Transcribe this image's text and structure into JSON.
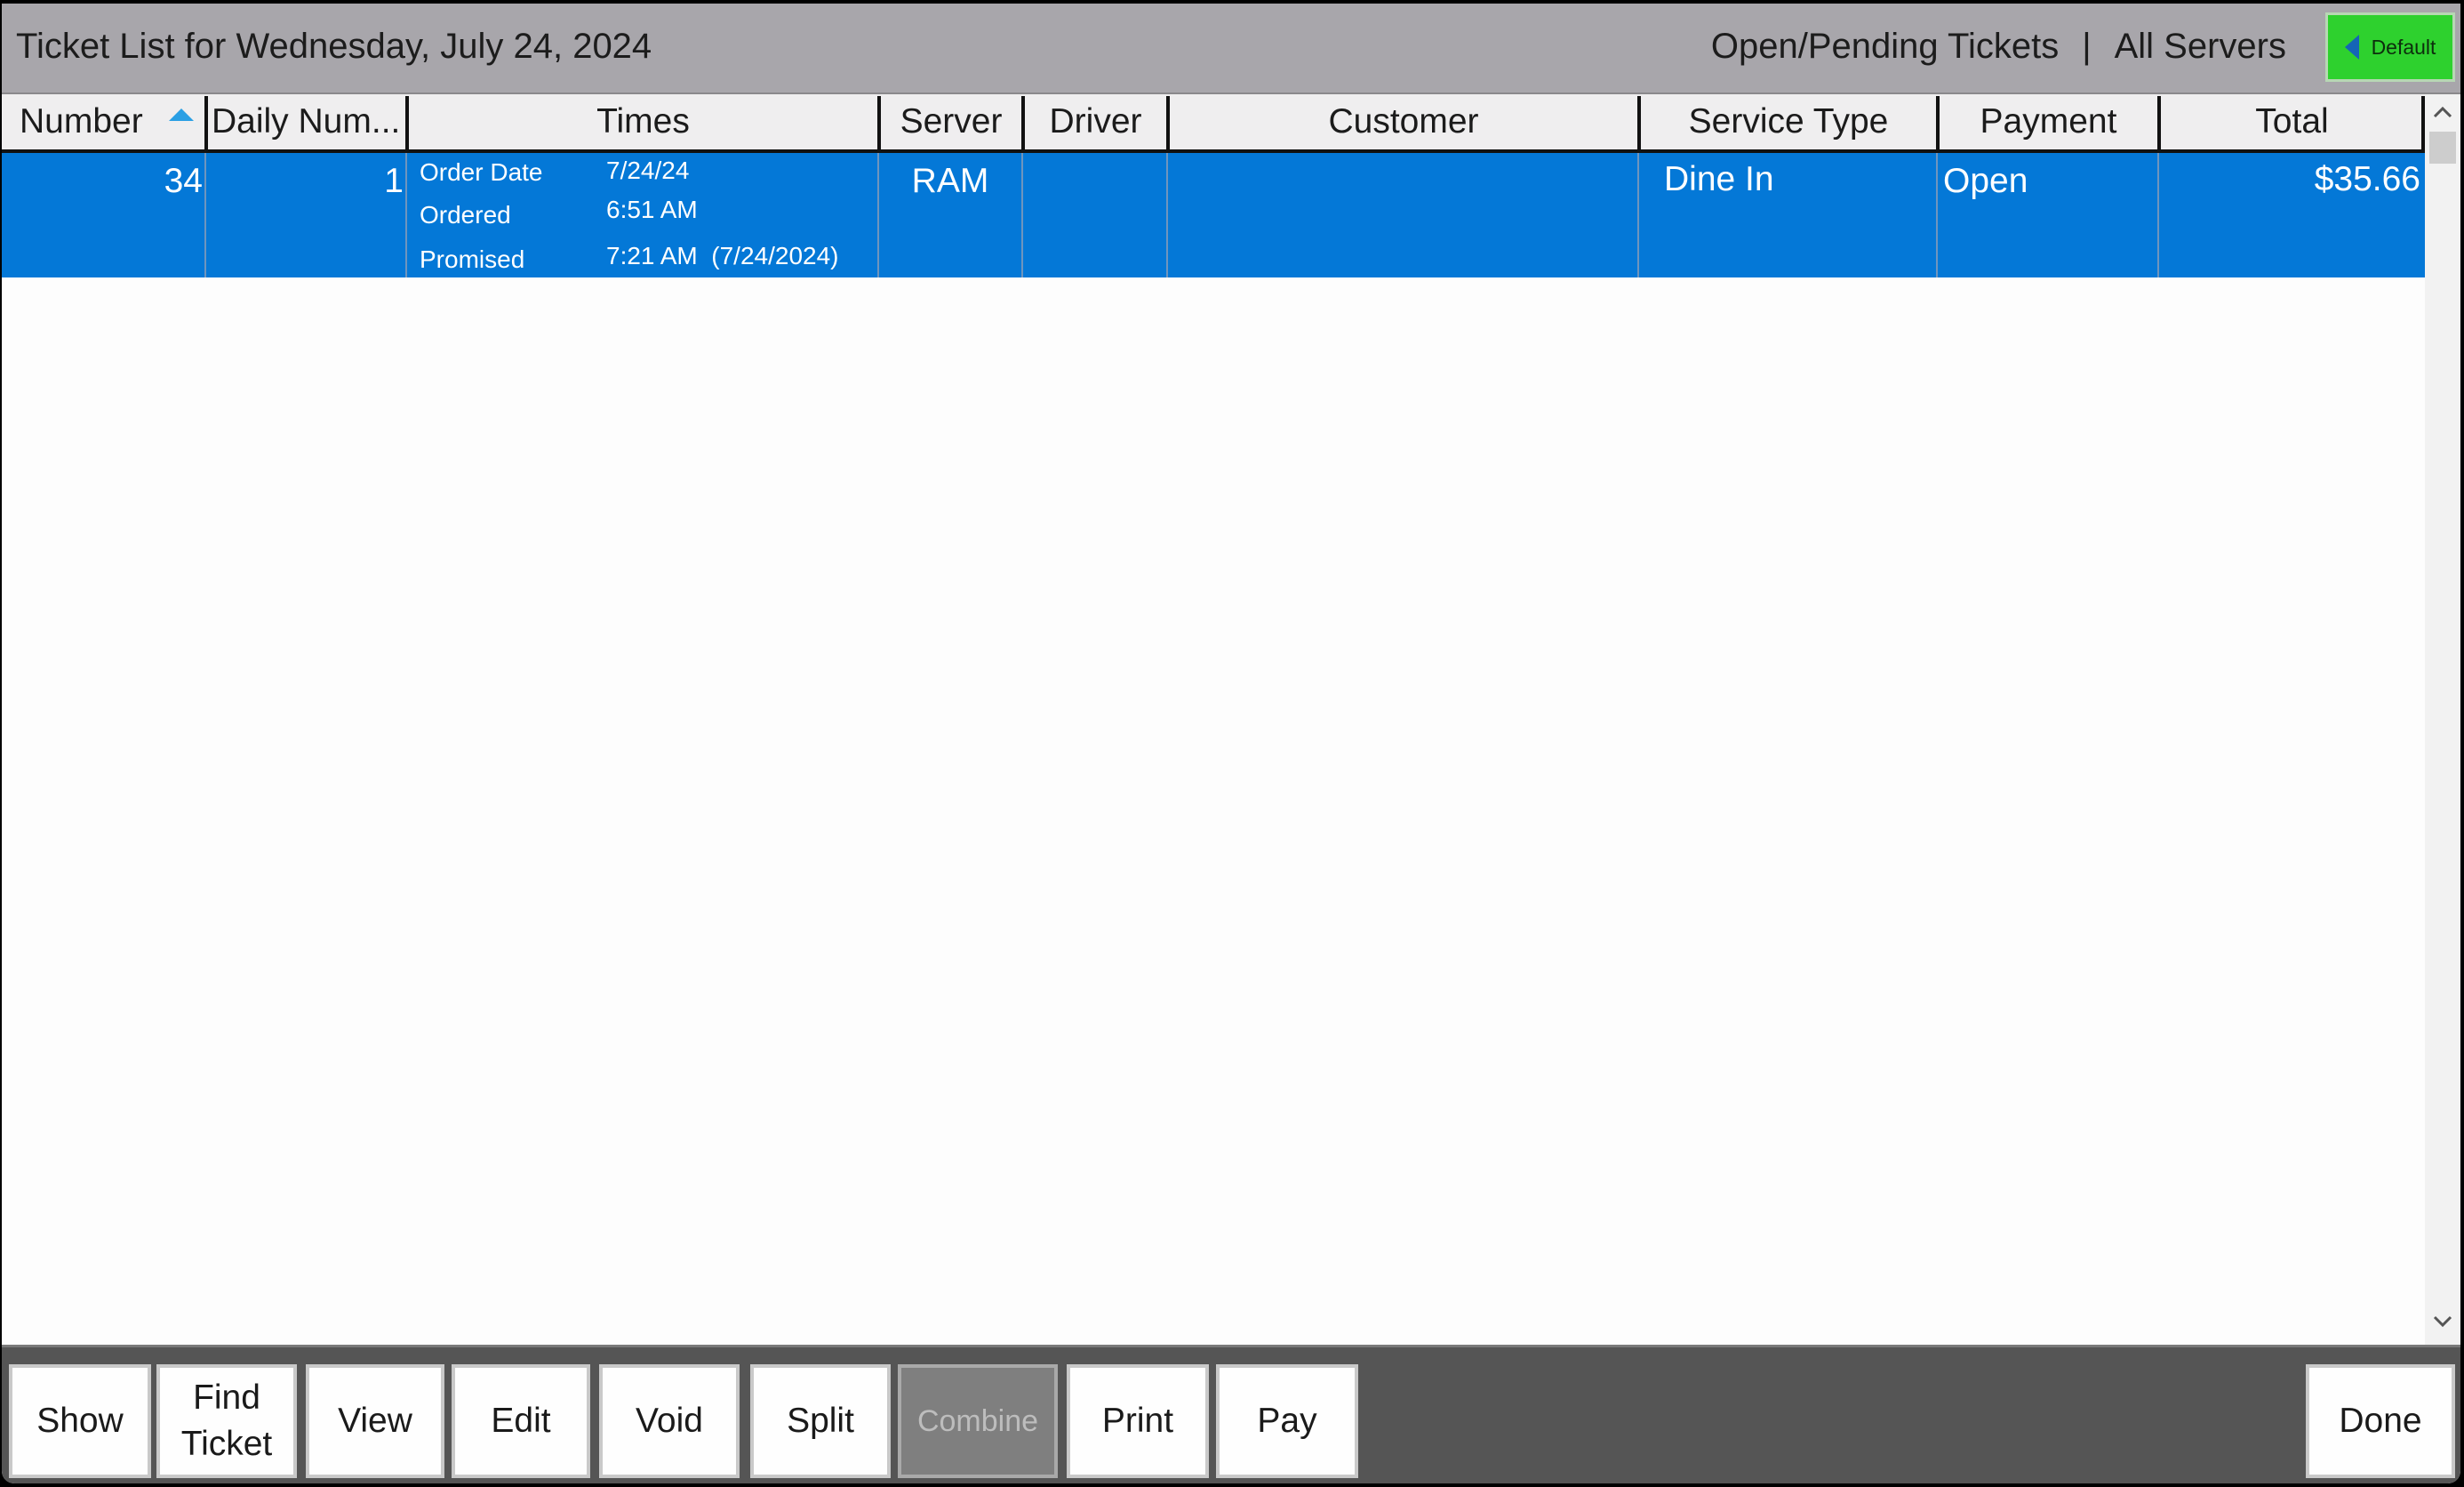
{
  "title_bar": {
    "title": "Ticket List for Wednesday, July 24, 2024",
    "filter_status": "Open/Pending Tickets",
    "separator": "|",
    "filter_server": "All Servers",
    "default_button": {
      "label": "Default",
      "icon": "caret-left-icon",
      "color": "#2ed12e"
    }
  },
  "grid": {
    "columns": [
      {
        "key": "number",
        "label": "Number",
        "sorted": "ascending"
      },
      {
        "key": "daily_number",
        "label": "Daily Num..."
      },
      {
        "key": "times",
        "label": "Times"
      },
      {
        "key": "server",
        "label": "Server"
      },
      {
        "key": "driver",
        "label": "Driver"
      },
      {
        "key": "customer",
        "label": "Customer"
      },
      {
        "key": "service_type",
        "label": "Service Type"
      },
      {
        "key": "payment",
        "label": "Payment"
      },
      {
        "key": "total",
        "label": "Total"
      }
    ],
    "rows": [
      {
        "selected": true,
        "number": "34",
        "daily_number": "1",
        "times": {
          "order_date_label": "Order Date",
          "order_date": "7/24/24",
          "ordered_label": "Ordered",
          "ordered": "6:51 AM",
          "promised_label": "Promised",
          "promised": "7:21 AM  (7/24/2024)"
        },
        "server": "RAM",
        "driver": "",
        "customer": "",
        "service_type": "Dine In",
        "payment": "Open",
        "total": "$35.66"
      }
    ],
    "selection_color": "#0478d7"
  },
  "scrollbar": {
    "up_icon": "chevron-up-icon",
    "down_icon": "chevron-down-icon"
  },
  "toolbar": {
    "buttons": [
      {
        "label": "Show",
        "enabled": true
      },
      {
        "label": "Find Ticket",
        "line1": "Find",
        "line2": "Ticket",
        "enabled": true
      },
      {
        "label": "View",
        "enabled": true
      },
      {
        "label": "Edit",
        "enabled": true
      },
      {
        "label": "Void",
        "enabled": true
      },
      {
        "label": "Split",
        "enabled": true
      },
      {
        "label": "Combine",
        "enabled": false
      },
      {
        "label": "Print",
        "enabled": true
      },
      {
        "label": "Pay",
        "enabled": true
      }
    ],
    "done_label": "Done"
  }
}
